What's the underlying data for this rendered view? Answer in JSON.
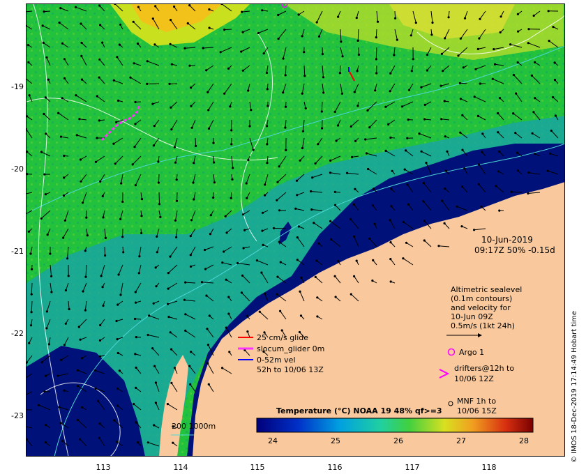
{
  "map": {
    "date": "10-Jun-2019",
    "time_info": "09:17Z  50% -0.15d",
    "y_ticks": [
      "-19",
      "-20",
      "-21",
      "-22",
      "-23"
    ],
    "x_ticks": [
      "113",
      "114",
      "115",
      "116",
      "117",
      "118"
    ],
    "y_tick_values": [
      -19,
      -20,
      -21,
      -22,
      -23
    ],
    "x_tick_values": [
      113,
      114,
      115,
      116,
      117,
      118
    ],
    "lon_range": [
      112.0,
      119.0
    ],
    "lat_range": [
      -18.05,
      -23.55
    ],
    "bathy_label": "200  1000m",
    "altimetry_lines": [
      "Altimetric sealevel",
      "(0.1m contours)",
      "and velocity for",
      "10-Jun 09Z",
      "0.5m/s (1kt 24h)"
    ],
    "glider_lines": [
      "25 cm/s glide",
      "slocum_glider 0m",
      "0-52m vel",
      "52h to 10/06 13Z"
    ],
    "argo_label": "Argo 1",
    "drifter_lines": [
      "drifters@12h to",
      "10/06 12Z"
    ],
    "mnf_lines": [
      "MNF 1h to",
      "10/06 15Z"
    ],
    "colorbar_title": "Temperature (°C) NOAA 19 48% qf>=3",
    "colorbar_ticks": [
      "24",
      "25",
      "26",
      "27",
      "28"
    ],
    "colorbar_values": [
      24,
      25,
      26,
      27,
      28
    ],
    "colorbar_range": [
      23.8,
      28.2
    ],
    "credit": "© IMOS 18-Dec-2019 17:14:49 Hobart time",
    "colors": {
      "land": "#f9c99d",
      "deep": "#00127a",
      "green": "#22c23c",
      "contour": "#ffffff",
      "isobath": "#4dd6d6",
      "glider_arrow": "#ff0000",
      "slocum": "#ff33ff",
      "vel": "#0000ff",
      "argo": "#ff00ff"
    }
  }
}
